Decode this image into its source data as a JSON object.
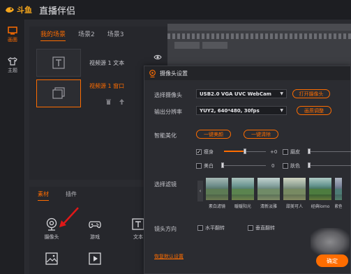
{
  "app": {
    "logo_text": "斗鱼",
    "title": "直播伴侣"
  },
  "sidebar": {
    "items": [
      {
        "label": "画面",
        "icon": "monitor-icon",
        "active": true
      },
      {
        "label": "主题",
        "icon": "shirt-icon",
        "active": false
      }
    ]
  },
  "scenes": {
    "tabs": [
      "我的场景",
      "场景2",
      "场景3"
    ],
    "active_tab": 0,
    "sources": [
      {
        "name": "视频源 1 文本",
        "icon": "text-icon",
        "selected": false
      },
      {
        "name": "视频源 1 窗口",
        "icon": "window-icon",
        "selected": true
      }
    ]
  },
  "material": {
    "tabs": [
      "素材",
      "插件"
    ],
    "items": [
      {
        "label": "摄像头",
        "icon": "camera-icon"
      },
      {
        "label": "游戏",
        "icon": "gamepad-icon"
      },
      {
        "label": "文本",
        "icon": "text-icon"
      },
      {
        "label": "",
        "icon": "image-icon"
      },
      {
        "label": "",
        "icon": "play-icon"
      }
    ]
  },
  "dialog": {
    "title": "摄像头设置",
    "select_camera_label": "选择摄像头",
    "camera_value": "USB2.0 VGA UVC WebCam",
    "open_camera": "打开摄像头",
    "resolution_label": "输出分辨率",
    "resolution_value": "YUY2, 640*480, 30fps",
    "adjust_button": "画质调整",
    "beauty_label": "智能美化",
    "one_key_beauty": "一键美颜",
    "one_key_clear": "一键清除",
    "sliders": [
      {
        "label": "瘦身",
        "checked": true,
        "value": "+0",
        "fill": 0.5
      },
      {
        "label": "磨皮",
        "checked": false,
        "value": "",
        "fill": 0.0
      },
      {
        "label": "美白",
        "checked": false,
        "value": "0",
        "fill": 0.0
      },
      {
        "label": "肤色",
        "checked": false,
        "value": "",
        "fill": 0.0
      }
    ],
    "filter_label": "选择滤镜",
    "filters": [
      "素白滤镜",
      "暖暖阳光",
      "清新淡雅",
      "甜美可人",
      "经典lomo",
      "紫色"
    ],
    "direction_label": "镜头方向",
    "mirror_horizontal": "水平翻转",
    "mirror_vertical": "垂直翻转",
    "restore_default": "恢复默认设置",
    "confirm": "确定"
  }
}
